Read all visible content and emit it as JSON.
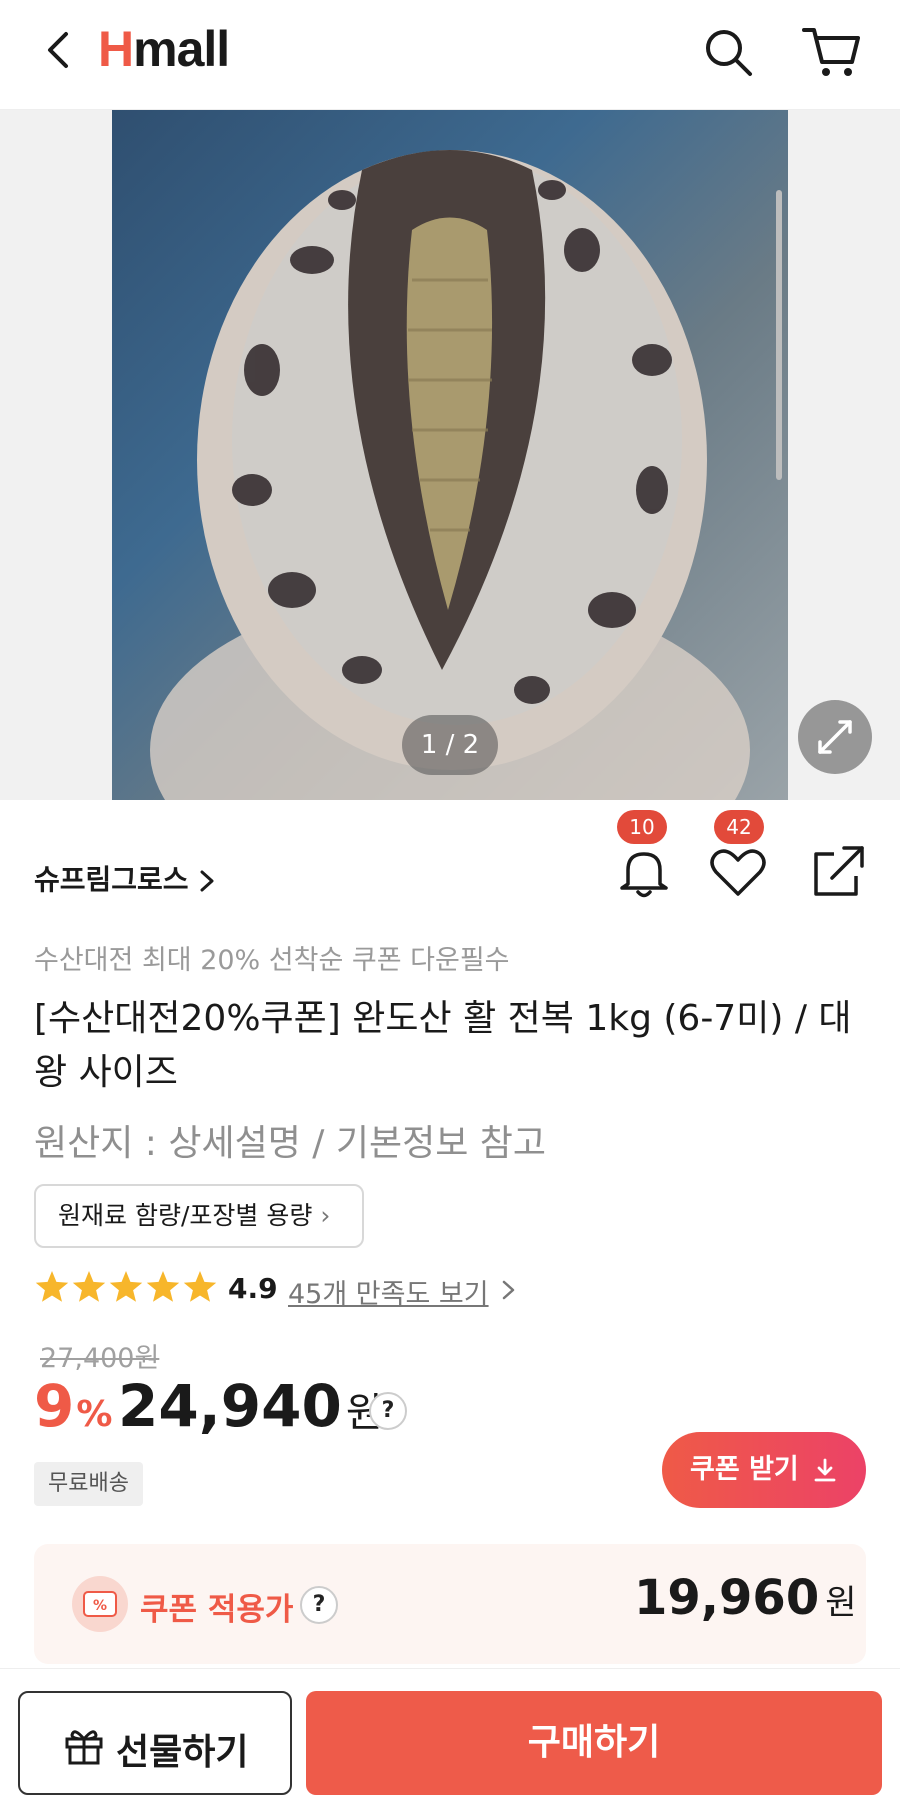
{
  "header": {
    "logo_h": "H",
    "logo_rest": "mall",
    "accent_color": "#ef5a47"
  },
  "gallery": {
    "counter": "1 / 2"
  },
  "seller": {
    "name": "슈프림그로스",
    "notification_count": "10",
    "wishlist_count": "42"
  },
  "product": {
    "promo_text": "수산대전 최대 20% 선착순 쿠폰 다운필수",
    "title": "[수산대전20%쿠폰] 완도산 활 전복 1kg (6-7미) / 대왕 사이즈",
    "origin": "원산지 : 상세설명 / 기본정보 참고",
    "info_button": "원재료 함량/포장별 용량",
    "rating": "4.9",
    "rating_stars": 5,
    "reviews_link": "45개 만족도 보기"
  },
  "price": {
    "original": "27,400원",
    "discount_number": "9",
    "discount_percent_sign": "%",
    "current": "24,940",
    "unit": "원",
    "help_symbol": "?",
    "free_shipping": "무료배송",
    "coupon_button": "쿠폰 받기"
  },
  "coupon": {
    "icon_text": "%",
    "label": "쿠폰 적용가",
    "help_symbol": "?",
    "price": "19,960",
    "unit": "원"
  },
  "bottom": {
    "gift_label": "선물하기",
    "buy_label": "구매하기"
  }
}
